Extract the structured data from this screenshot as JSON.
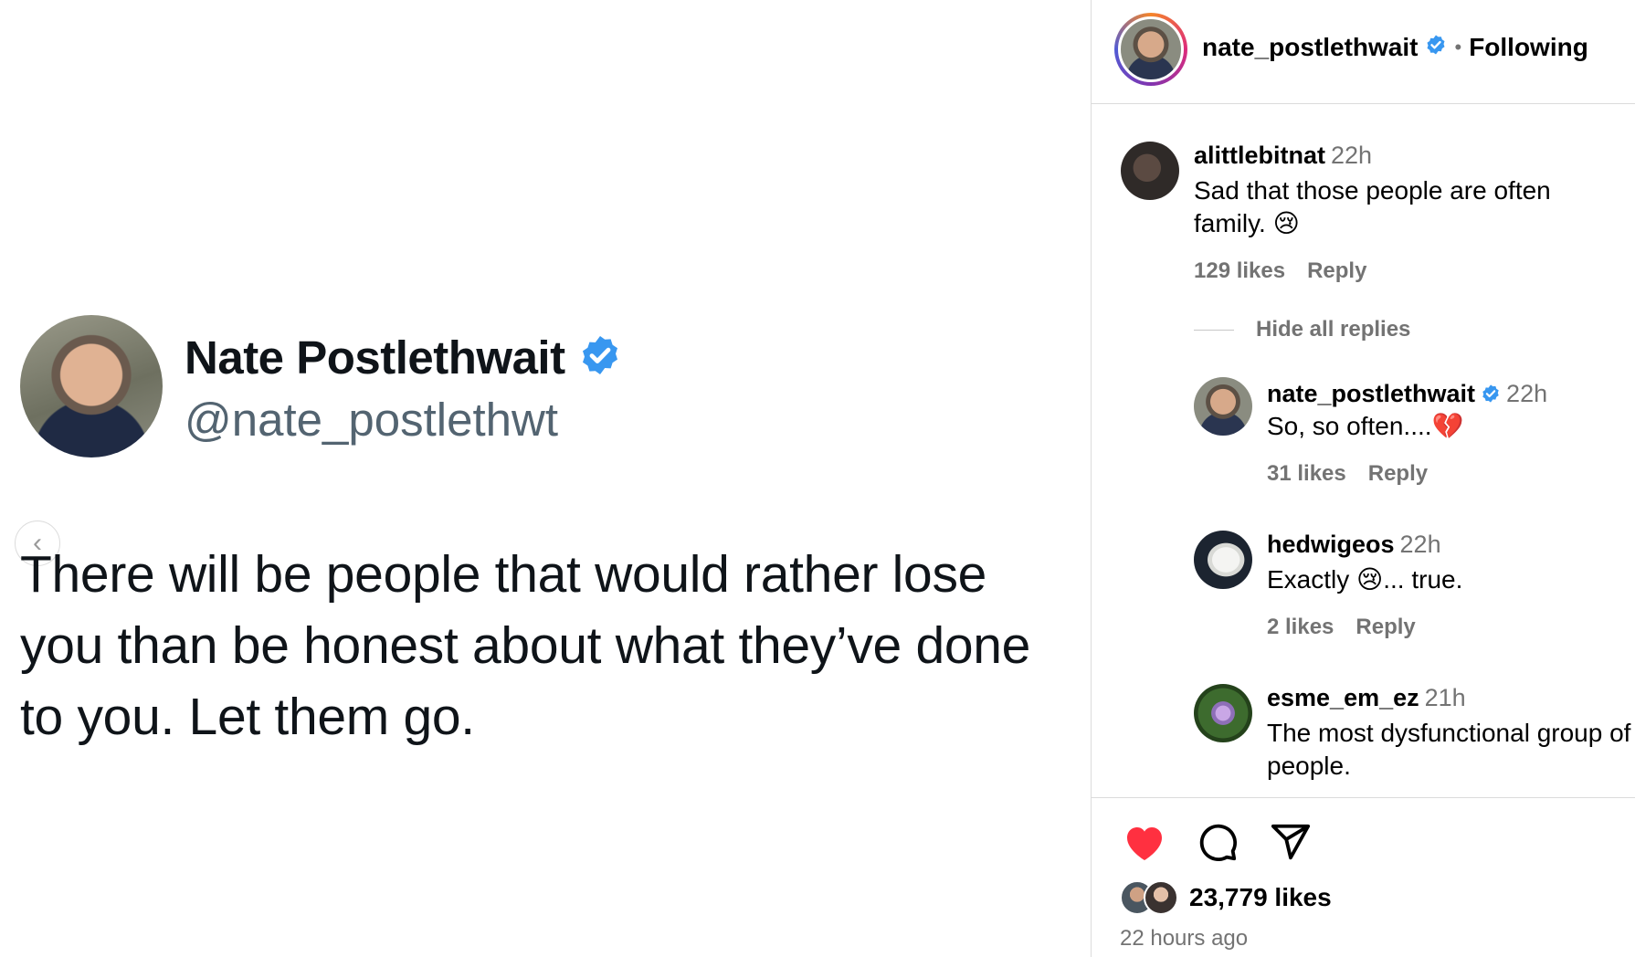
{
  "tweet": {
    "display_name": "Nate Postlethwait",
    "handle": "@nate_postlethwt",
    "text": "There will be people that would rather lose you than be honest about what they’ve done to you. Let them go.",
    "prev_glyph": "‹"
  },
  "header": {
    "username": "nate_postlethwait",
    "separator": "•",
    "follow_status": "Following"
  },
  "comments": [
    {
      "username": "alittlebitnat",
      "time": "22h",
      "text": "Sad that those people are often family. 😢",
      "likes": "129 likes",
      "reply": "Reply"
    },
    {
      "username": "nate_postlethwait",
      "time": "22h",
      "text": "So, so often....💔",
      "likes": "31 likes",
      "reply": "Reply"
    },
    {
      "username": "hedwigeos",
      "time": "22h",
      "text": "Exactly 😢... true.",
      "likes": "2 likes",
      "reply": "Reply"
    },
    {
      "username": "esme_em_ez",
      "time": "21h",
      "text": "The most dysfunctional group of people.",
      "likes": "",
      "reply": ""
    }
  ],
  "hide_replies_label": "Hide all replies",
  "footer": {
    "likes": "23,779 likes",
    "posted": "22 hours ago"
  },
  "colors": {
    "verified": "#3897f0",
    "liked": "#ff3040",
    "muted": "#737373"
  },
  "icons": [
    "verified-badge-icon",
    "heart-icon",
    "comment-icon",
    "share-icon",
    "chevron-left-icon"
  ]
}
